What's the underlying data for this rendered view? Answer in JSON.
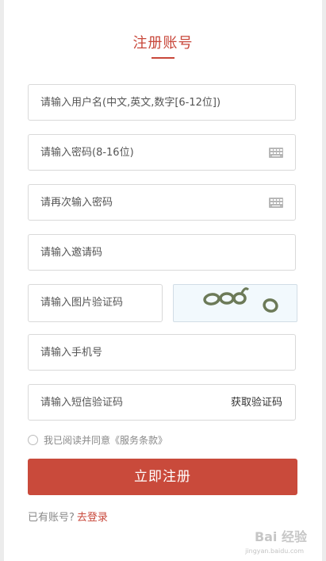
{
  "form": {
    "title": "注册账号",
    "username_placeholder": "请输入用户名(中文,英文,数字[6-12位])",
    "password_placeholder": "请输入密码(8-16位)",
    "confirm_password_placeholder": "请再次输入密码",
    "invite_code_placeholder": "请输入邀请码",
    "captcha_placeholder": "请输入图片验证码",
    "phone_placeholder": "请输入手机号",
    "sms_code_placeholder": "请输入短信验证码",
    "get_sms_code_label": "获取验证码",
    "agreement_text": "我已阅读并同意《服务条款》",
    "submit_label": "立即注册",
    "have_account_text": "已有账号?",
    "login_link": "去登录"
  },
  "colors": {
    "accent": "#c8473a",
    "button": "#c94a3b",
    "border": "#d9d9d9"
  },
  "watermark": {
    "text": "Bai 经验",
    "sub": "jingyan.baidu.com"
  }
}
